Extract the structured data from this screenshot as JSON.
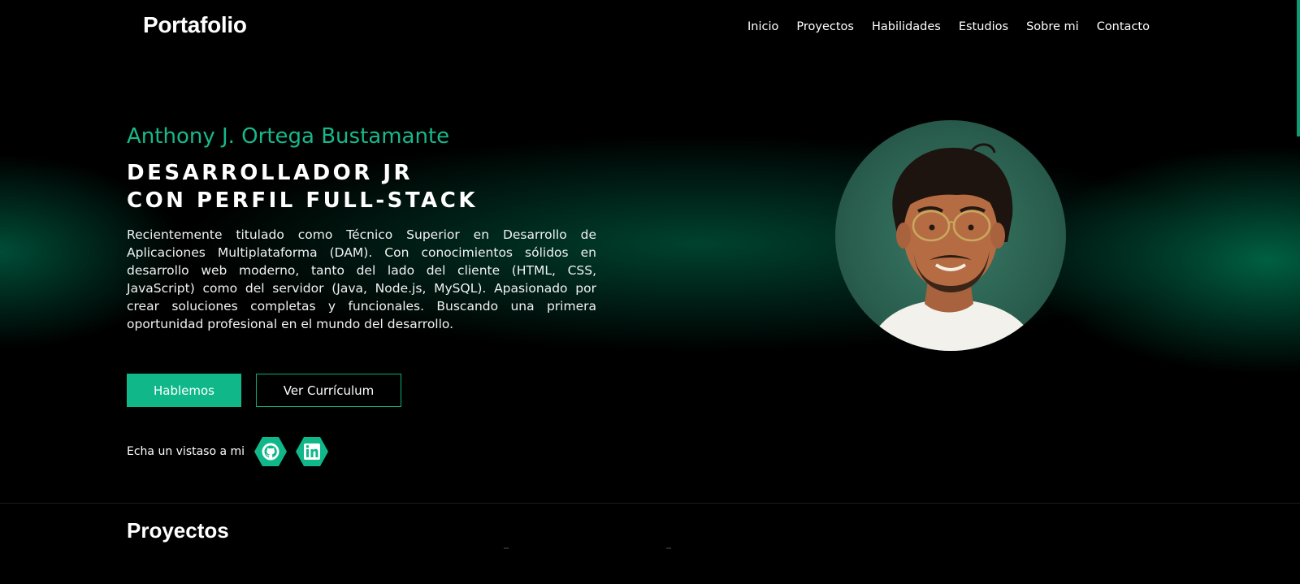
{
  "header": {
    "logo": "Portafolio",
    "nav": [
      "Inicio",
      "Proyectos",
      "Habilidades",
      "Estudios",
      "Sobre mi",
      "Contacto"
    ]
  },
  "hero": {
    "name": "Anthony J. Ortega Bustamante",
    "role_line1": "DESARROLLADOR JR",
    "role_line2": "CON PERFIL FULL-STACK",
    "description": "Recientemente titulado como Técnico Superior en Desarrollo de Aplicaciones Multiplataforma (DAM). Con conocimientos sólidos en desarrollo web moderno, tanto del lado del cliente (HTML, CSS, JavaScript) como del servidor (Java, Node.js, MySQL). Apasionado por crear soluciones completas y funcionales. Buscando una primera oportunidad profesional en el mundo del desarrollo.",
    "primary_button": "Hablemos",
    "secondary_button": "Ver Currículum",
    "social_label": "Echa un vistaso a mi",
    "social_icons": [
      "github-icon",
      "linkedin-icon"
    ]
  },
  "sections": {
    "projects_title": "Proyectos"
  },
  "colors": {
    "accent": "#10b889",
    "name_color": "#17b88b",
    "background": "#000000"
  }
}
